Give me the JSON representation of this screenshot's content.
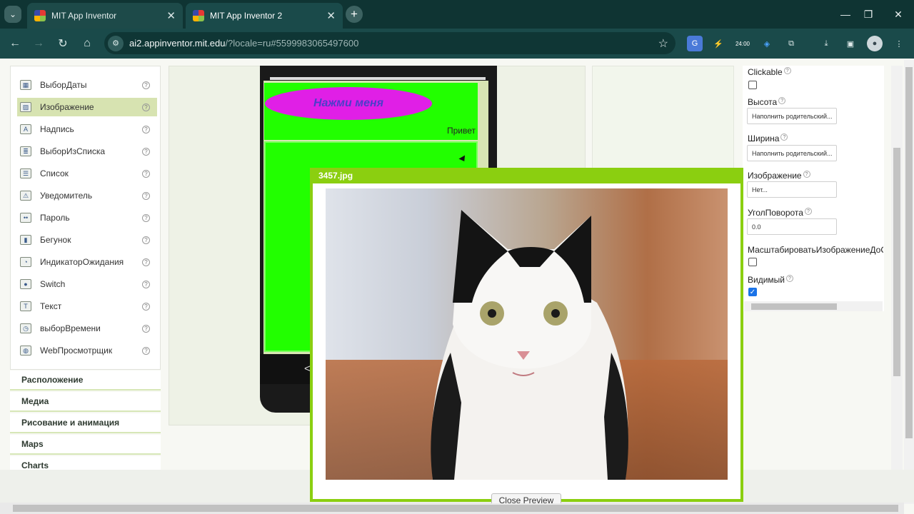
{
  "browser": {
    "tabs": [
      {
        "title": "MIT App Inventor"
      },
      {
        "title": "MIT App Inventor 2"
      }
    ],
    "url_host": "ai2.appinventor.mit.edu",
    "url_path": "/?locale=ru#5599983065497600",
    "ext_timer": "24:00"
  },
  "palette": {
    "items": [
      {
        "label": "ВыборДаты",
        "icon": "date-picker-icon"
      },
      {
        "label": "Изображение",
        "icon": "image-icon",
        "selected": true
      },
      {
        "label": "Надпись",
        "icon": "label-icon"
      },
      {
        "label": "ВыборИзСписка",
        "icon": "list-picker-icon"
      },
      {
        "label": "Список",
        "icon": "list-view-icon"
      },
      {
        "label": "Уведомитель",
        "icon": "notifier-icon"
      },
      {
        "label": "Пароль",
        "icon": "password-icon"
      },
      {
        "label": "Бегунок",
        "icon": "slider-icon"
      },
      {
        "label": "ИндикаторОжидания",
        "icon": "spinner-icon"
      },
      {
        "label": "Switch",
        "icon": "switch-icon"
      },
      {
        "label": "Текст",
        "icon": "textbox-icon"
      },
      {
        "label": "выборВремени",
        "icon": "time-picker-icon"
      },
      {
        "label": "WebПросмотрщик",
        "icon": "web-viewer-icon"
      }
    ],
    "categories": [
      "Расположение",
      "Медиа",
      "Рисование и анимация",
      "Maps",
      "Charts"
    ]
  },
  "viewer": {
    "button_text": "Нажми меня",
    "label_text": "Привет"
  },
  "properties": {
    "clickable": "Clickable",
    "height_label": "Высота",
    "height_value": "Наполнить родительский...",
    "width_label": "Ширина",
    "width_value": "Наполнить родительский...",
    "picture_label": "Изображение",
    "picture_value": "Нет...",
    "rotation_label": "УголПоворота",
    "rotation_value": "0.0",
    "scale_label": "МасштабироватьИзображениеДоСо",
    "visible_label": "Видимый"
  },
  "preview": {
    "title": "3457.jpg",
    "close_label": "Close Preview"
  },
  "colors": {
    "accent": "#8bcf10",
    "viewer_green": "#22ff00",
    "button_magenta": "#e01fe6"
  }
}
